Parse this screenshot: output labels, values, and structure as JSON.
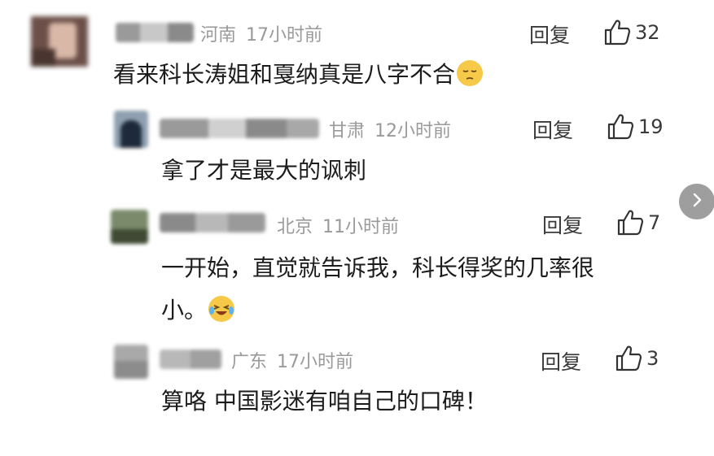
{
  "comments": [
    {
      "location": "河南",
      "time": "17小时前",
      "reply_label": "回复",
      "likes": "32",
      "text": "看来科长涛姐和戛纳真是八字不合",
      "emoji": "pensive-face-emoji"
    },
    {
      "location": "甘肃",
      "time": "12小时前",
      "reply_label": "回复",
      "likes": "19",
      "text": "拿了才是最大的讽刺"
    },
    {
      "location": "北京",
      "time": "11小时前",
      "reply_label": "回复",
      "likes": "7",
      "text_line1": "一开始，直觉就告诉我，科长得奖的几率很",
      "text_line2": "小。",
      "emoji": "crying-laughing-emoji"
    },
    {
      "location": "广东",
      "time": "17小时前",
      "reply_label": "回复",
      "likes": "3",
      "text": "算咯 中国影迷有咱自己的口碑！"
    }
  ],
  "icons": {
    "like": "thumbs-up-icon",
    "next": "chevron-right-icon"
  },
  "colors": {
    "meta_text": "#9a9a9a",
    "next_button": "#9e9e9e"
  }
}
